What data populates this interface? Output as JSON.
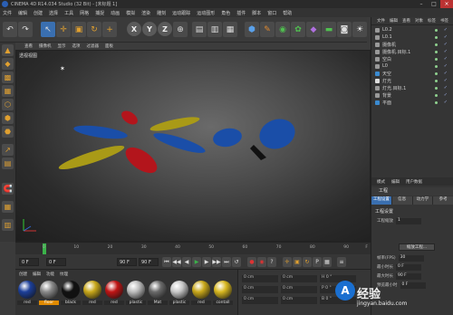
{
  "window": {
    "title": "CINEMA 4D R14.034 Studio (32 Bit) - [未标题 1]"
  },
  "menubar": [
    "文件",
    "编辑",
    "创建",
    "选择",
    "工具",
    "网格",
    "捕捉",
    "动画",
    "模拟",
    "渲染",
    "雕刻",
    "运动跟踪",
    "运动图形",
    "角色",
    "插件",
    "脚本",
    "窗口",
    "帮助"
  ],
  "toolbar": {
    "xyz": [
      "X",
      "Y",
      "Z"
    ]
  },
  "viewport": {
    "menu": [
      "查看",
      "摄像机",
      "显示",
      "选项",
      "过滤器",
      "面板"
    ],
    "label": "透视视图"
  },
  "scene_colors": {
    "red": "#b3151c",
    "blue": "#1a4ea8",
    "yellow": "#a99a17"
  },
  "timeline": {
    "ticks": [
      "0",
      "10",
      "20",
      "30",
      "40",
      "50",
      "60",
      "70",
      "80",
      "90"
    ],
    "end": "F"
  },
  "transport": {
    "start": "0 F",
    "current": "0 F",
    "end": "90 F",
    "end2": "90 F"
  },
  "materials": {
    "menu": [
      "创建",
      "编辑",
      "功能",
      "纹理"
    ],
    "items": [
      {
        "name": "red",
        "color": "#1c3f99",
        "selected": false
      },
      {
        "name": "floor",
        "color": "#8a8a8a",
        "selected": true
      },
      {
        "name": "black",
        "color": "#111111",
        "selected": false
      },
      {
        "name": "red",
        "color": "#c9a81a",
        "selected": false
      },
      {
        "name": "red",
        "color": "#c01515",
        "selected": false
      },
      {
        "name": "plastic",
        "color": "#bdbdbd",
        "selected": false
      },
      {
        "name": "Mat",
        "color": "#6a6a6a",
        "selected": false
      },
      {
        "name": "plastic",
        "color": "#c8c8c8",
        "selected": false
      },
      {
        "name": "red",
        "color": "#c9a81a",
        "selected": false
      },
      {
        "name": "contall",
        "color": "#d8b820",
        "selected": false
      }
    ]
  },
  "coords": {
    "rows": [
      [
        "0 cm",
        "0 cm",
        "H 0 °"
      ],
      [
        "0 cm",
        "0 cm",
        "P 0 °"
      ],
      [
        "0 cm",
        "0 cm",
        "B 0 °"
      ]
    ]
  },
  "object_manager": {
    "menu": [
      "文件",
      "编辑",
      "查看",
      "对象",
      "标签",
      "书签"
    ],
    "objects": [
      {
        "name": "L0.2",
        "color": "#9a9a9a"
      },
      {
        "name": "L0.1",
        "color": "#9a9a9a"
      },
      {
        "name": "摄像机",
        "color": "#9a9a9a"
      },
      {
        "name": "摄像机.目标.1",
        "color": "#9a9a9a"
      },
      {
        "name": "空白",
        "color": "#9a9a9a"
      },
      {
        "name": "L0",
        "color": "#9a9a9a"
      },
      {
        "name": "天空",
        "color": "#3a8ad0"
      },
      {
        "name": "灯光",
        "color": "#ddd"
      },
      {
        "name": "灯光.目标.1",
        "color": "#9a9a9a"
      },
      {
        "name": "背景",
        "color": "#9a9a9a"
      },
      {
        "name": "平面",
        "color": "#3a8ad0"
      }
    ]
  },
  "attributes": {
    "tabs": [
      "模式",
      "编辑",
      "用户数据"
    ],
    "header": "工程",
    "subtabs": [
      "工程设置",
      "信息",
      "动力学",
      "参考"
    ],
    "section": "工程设置",
    "rows": [
      {
        "label": "工程缩放",
        "value": "1"
      },
      {
        "label": "帧率(FPS)",
        "value": "30"
      },
      {
        "label": "最小时长",
        "value": "0 F"
      },
      {
        "label": "最大时长",
        "value": "90 F"
      },
      {
        "label": "预览最小时",
        "value": "0 F"
      }
    ],
    "apply_button": "缩放工程..."
  },
  "watermark": {
    "badge": "A",
    "text": "经验",
    "url": "jingyan.baidu.com"
  }
}
